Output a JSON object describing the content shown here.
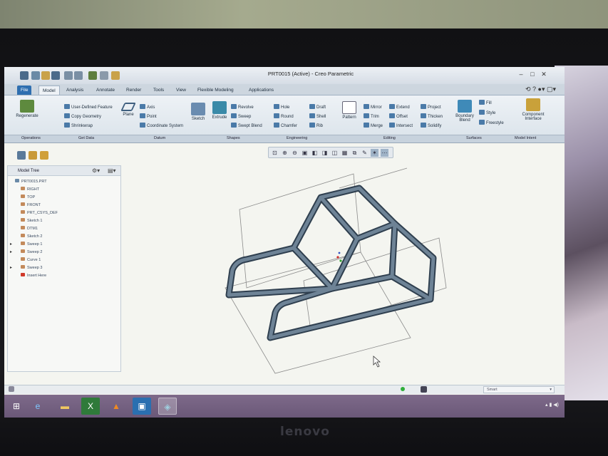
{
  "window": {
    "title": "PRT0015 (Active) - Creo Parametric"
  },
  "menu": {
    "file": "File",
    "tabs": [
      "Model",
      "Analysis",
      "Annotate",
      "Render",
      "Tools",
      "View",
      "Flexible Modeling",
      "Applications"
    ]
  },
  "ribbon": {
    "operations": {
      "regenerate": "Regenerate"
    },
    "get_data": {
      "user_defined": "User-Defined Feature",
      "copy_geometry": "Copy Geometry",
      "shrinkwrap": "Shrinkwrap"
    },
    "datum": {
      "plane": "Plane",
      "axis": "Axis",
      "point": "Point",
      "csys": "Coordinate System",
      "sketch": "Sketch"
    },
    "shapes": {
      "extrude": "Extrude",
      "revolve": "Revolve",
      "sweep": "Sweep",
      "swept_blend": "Swept Blend"
    },
    "engineering": {
      "hole": "Hole",
      "round": "Round",
      "chamfer": "Chamfer",
      "draft": "Draft",
      "shell": "Shell",
      "rib": "Rib"
    },
    "editing": {
      "pattern": "Pattern",
      "mirror": "Mirror",
      "trim": "Trim",
      "merge": "Merge",
      "extend": "Extend",
      "offset": "Offset",
      "intersect": "Intersect",
      "project": "Project",
      "thicken": "Thicken",
      "solidify": "Solidify"
    },
    "surfaces": {
      "boundary_blend": "Boundary Blend",
      "fill": "Fill",
      "style": "Style",
      "freestyle": "Freestyle"
    },
    "model_intent": {
      "component_interface": "Component Interface"
    },
    "groups": [
      "Operations",
      "Get Data",
      "Datum",
      "Shapes",
      "Engineering",
      "Editing",
      "Surfaces",
      "Model Intent"
    ]
  },
  "model_tree": {
    "title": "Model Tree",
    "items": [
      {
        "label": "PRT0015.PRT",
        "expand": ""
      },
      {
        "label": "RIGHT",
        "expand": ""
      },
      {
        "label": "TOP",
        "expand": ""
      },
      {
        "label": "FRONT",
        "expand": ""
      },
      {
        "label": "PRT_CSYS_DEF",
        "expand": ""
      },
      {
        "label": "Sketch 1",
        "expand": ""
      },
      {
        "label": "DTM1",
        "expand": ""
      },
      {
        "label": "Sketch 2",
        "expand": ""
      },
      {
        "label": "Sweep 1",
        "expand": "▸"
      },
      {
        "label": "Sweep 2",
        "expand": "▸"
      },
      {
        "label": "Curve 1",
        "expand": ""
      },
      {
        "label": "Sweep 3",
        "expand": "▸"
      },
      {
        "label": "Insert Here",
        "expand": ""
      }
    ]
  },
  "status": {
    "smart_filter": "Smart"
  },
  "bezel": {
    "brand": "lenovo"
  },
  "colors": {
    "accent": "#2f6fb0",
    "tube": "#5b6f82",
    "taskbar": "#6a5878"
  },
  "icons": [
    "regenerate-icon",
    "plane-icon",
    "sketch-icon",
    "extrude-icon",
    "pattern-icon",
    "boundary-blend-icon",
    "component-interface-icon"
  ]
}
